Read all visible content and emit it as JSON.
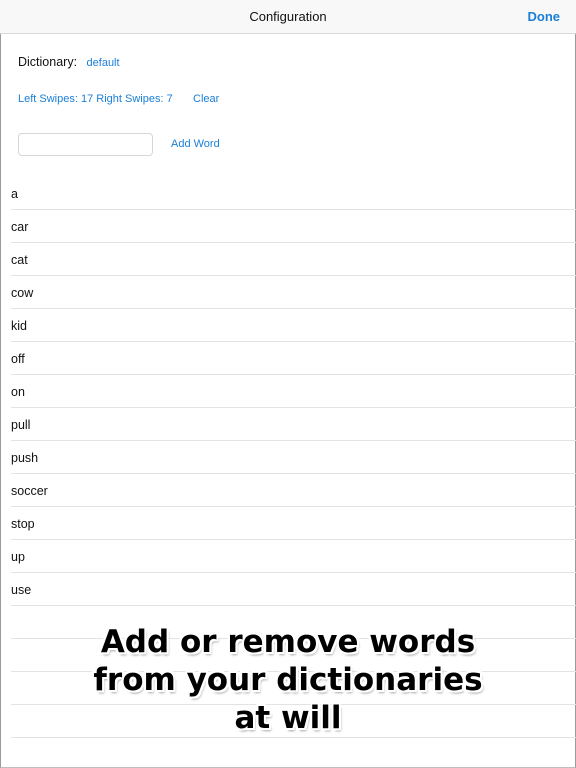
{
  "navbar": {
    "title": "Configuration",
    "done_label": "Done"
  },
  "dictionary": {
    "label": "Dictionary:",
    "value": "default"
  },
  "stats": {
    "swipes_text": "Left Swipes: 17 Right Swipes: 7",
    "clear_label": "Clear"
  },
  "add_word": {
    "input_value": "",
    "input_placeholder": "",
    "button_label": "Add Word"
  },
  "words": [
    "a",
    "car",
    "cat",
    "cow",
    "kid",
    "off",
    "on",
    "pull",
    "push",
    "soccer",
    "stop",
    "up",
    "use"
  ],
  "promo": {
    "lines": [
      "Add or remove words",
      "from your dictionaries",
      "at will"
    ]
  },
  "colors": {
    "accent": "#1a7fd6",
    "navbar_bg": "#f8f8f8",
    "separator": "#e3e3e3"
  }
}
